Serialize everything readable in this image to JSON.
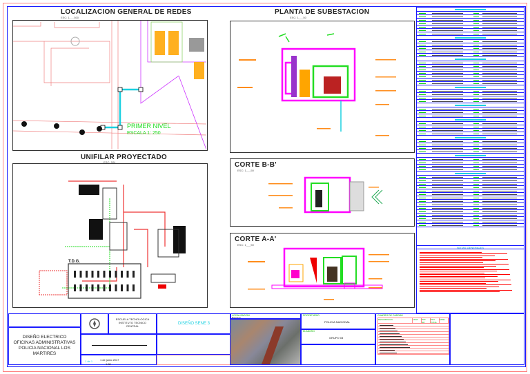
{
  "sheet": {
    "titles": {
      "localizacion": "LOCALIZACION GENERAL DE REDES",
      "localizacion_scale": "ESC: 1___500",
      "planta": "PLANTA DE SUBESTACION",
      "planta_scale": "ESC: 1___50",
      "unifilar": "UNIFILAR PROYECTADO",
      "unifilar_scale": "ESC: S/N",
      "corte_b": "CORTE B-B'",
      "corte_b_scale": "ESC: 1___50",
      "corte_a": "CORTE A-A'",
      "corte_a_scale": "ESC: 1___50"
    },
    "map": {
      "level": "PRIMER NIVEL",
      "scale": "ESCALA 1: 250"
    },
    "unifilar": {
      "board": "T.D.G."
    },
    "legend": {
      "notes_header": "NOTAS GENERALES"
    },
    "title_block": {
      "project_lines": [
        "DISEÑO ELECTRICO",
        "OFICINAS ADMINISTRATIVAS",
        "POLICIA NACIONAL LOS",
        "MARTIRES"
      ],
      "school_lines": [
        "ESCUELA TECNOLOGICA",
        "INSTITUTO TECNICO",
        "CENTRAL"
      ],
      "design": "DISEÑO SENE 3",
      "date": "1 de junio 2017",
      "scale": "1:50",
      "sheet": "1 de 1",
      "owner": "POLICIA NACIONAL",
      "group": "GRUPO 03",
      "location_label": "LOCALIZACION",
      "location_value": "Bogota D.",
      "owner_label": "PROPIETARIO",
      "group_label": "ELABORO",
      "table_header": "CUADRO DE CARGAS",
      "table_cols": [
        "DESCRIPCION",
        "CANT.",
        "POT. (W)",
        "POT. TOTAL",
        "FASE"
      ]
    }
  },
  "colors": {
    "frame": "#1a1aff",
    "accent_green": "#00cc00",
    "magenta": "#ff00ff",
    "red": "#ff0000",
    "cyan": "#1ad0e0",
    "orange": "#ff8c1a"
  }
}
